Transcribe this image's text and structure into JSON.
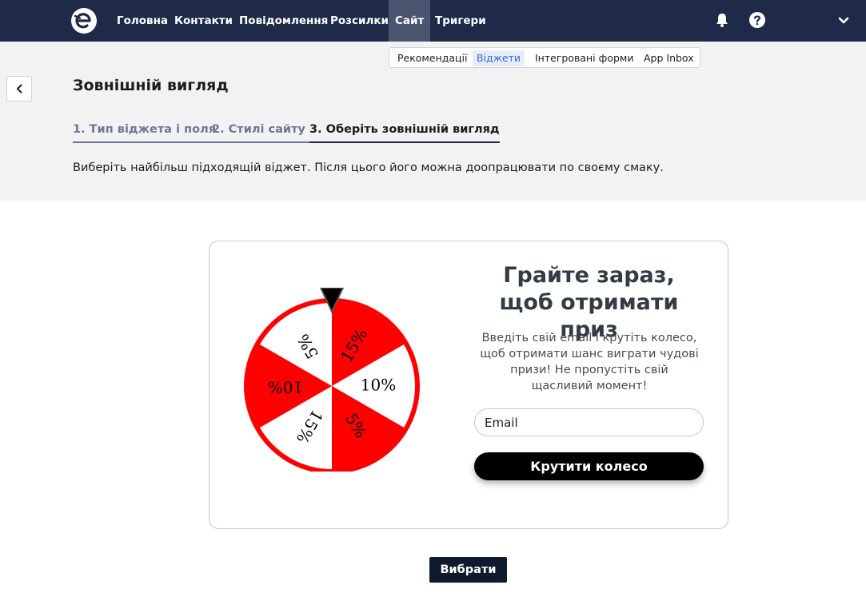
{
  "nav": {
    "logo_icon": "brand-e-logo",
    "items": [
      {
        "label": "Головна"
      },
      {
        "label": "Контакти"
      },
      {
        "label": "Повідомлення"
      },
      {
        "label": "Розсилки"
      },
      {
        "label": "Сайт",
        "active": true
      },
      {
        "label": "Тригери"
      }
    ],
    "icons": [
      "bell-icon",
      "help-icon",
      "chevron-down-icon"
    ]
  },
  "subnav": {
    "items": [
      {
        "label": "Рекомендації"
      },
      {
        "label": "Віджети",
        "active": true
      },
      {
        "label": "Інтегровані форми"
      },
      {
        "label": "App Inbox"
      }
    ]
  },
  "page": {
    "title": "Зовнішній вигляд",
    "back_icon": "chevron-left-icon",
    "steps": [
      {
        "label": "1. Тип віджета і поля"
      },
      {
        "label": "2. Стилі сайту"
      },
      {
        "label": "3. Оберіть зовнішній вигляд",
        "current": true
      }
    ],
    "instruction": "Виберіть найбільш підходящій віджет. Після цього його можна доопрацювати по своєму смаку."
  },
  "widget": {
    "wheel_segments": [
      {
        "label": "5%",
        "color": "#ff0000"
      },
      {
        "label": "10%",
        "color": "#ffffff"
      },
      {
        "label": "15%",
        "color": "#ff0000"
      },
      {
        "label": "5%",
        "color": "#ffffff"
      },
      {
        "label": "10%",
        "color": "#ff0000"
      },
      {
        "label": "15%",
        "color": "#ffffff"
      }
    ],
    "title": "Грайте зараз, щоб отримати приз",
    "text": "Введіть свій email і крутіть колесо, щоб отримати шанс виграти чудові призи! Не пропустіть свій щасливий момент!",
    "email_placeholder": "Email",
    "button": "Крутити колесо"
  },
  "actions": {
    "select": "Вибрати"
  },
  "colors": {
    "nav_bg": "#1e2a47",
    "accent_red": "#ff0000",
    "subnav_active": "#2f6bd8"
  }
}
